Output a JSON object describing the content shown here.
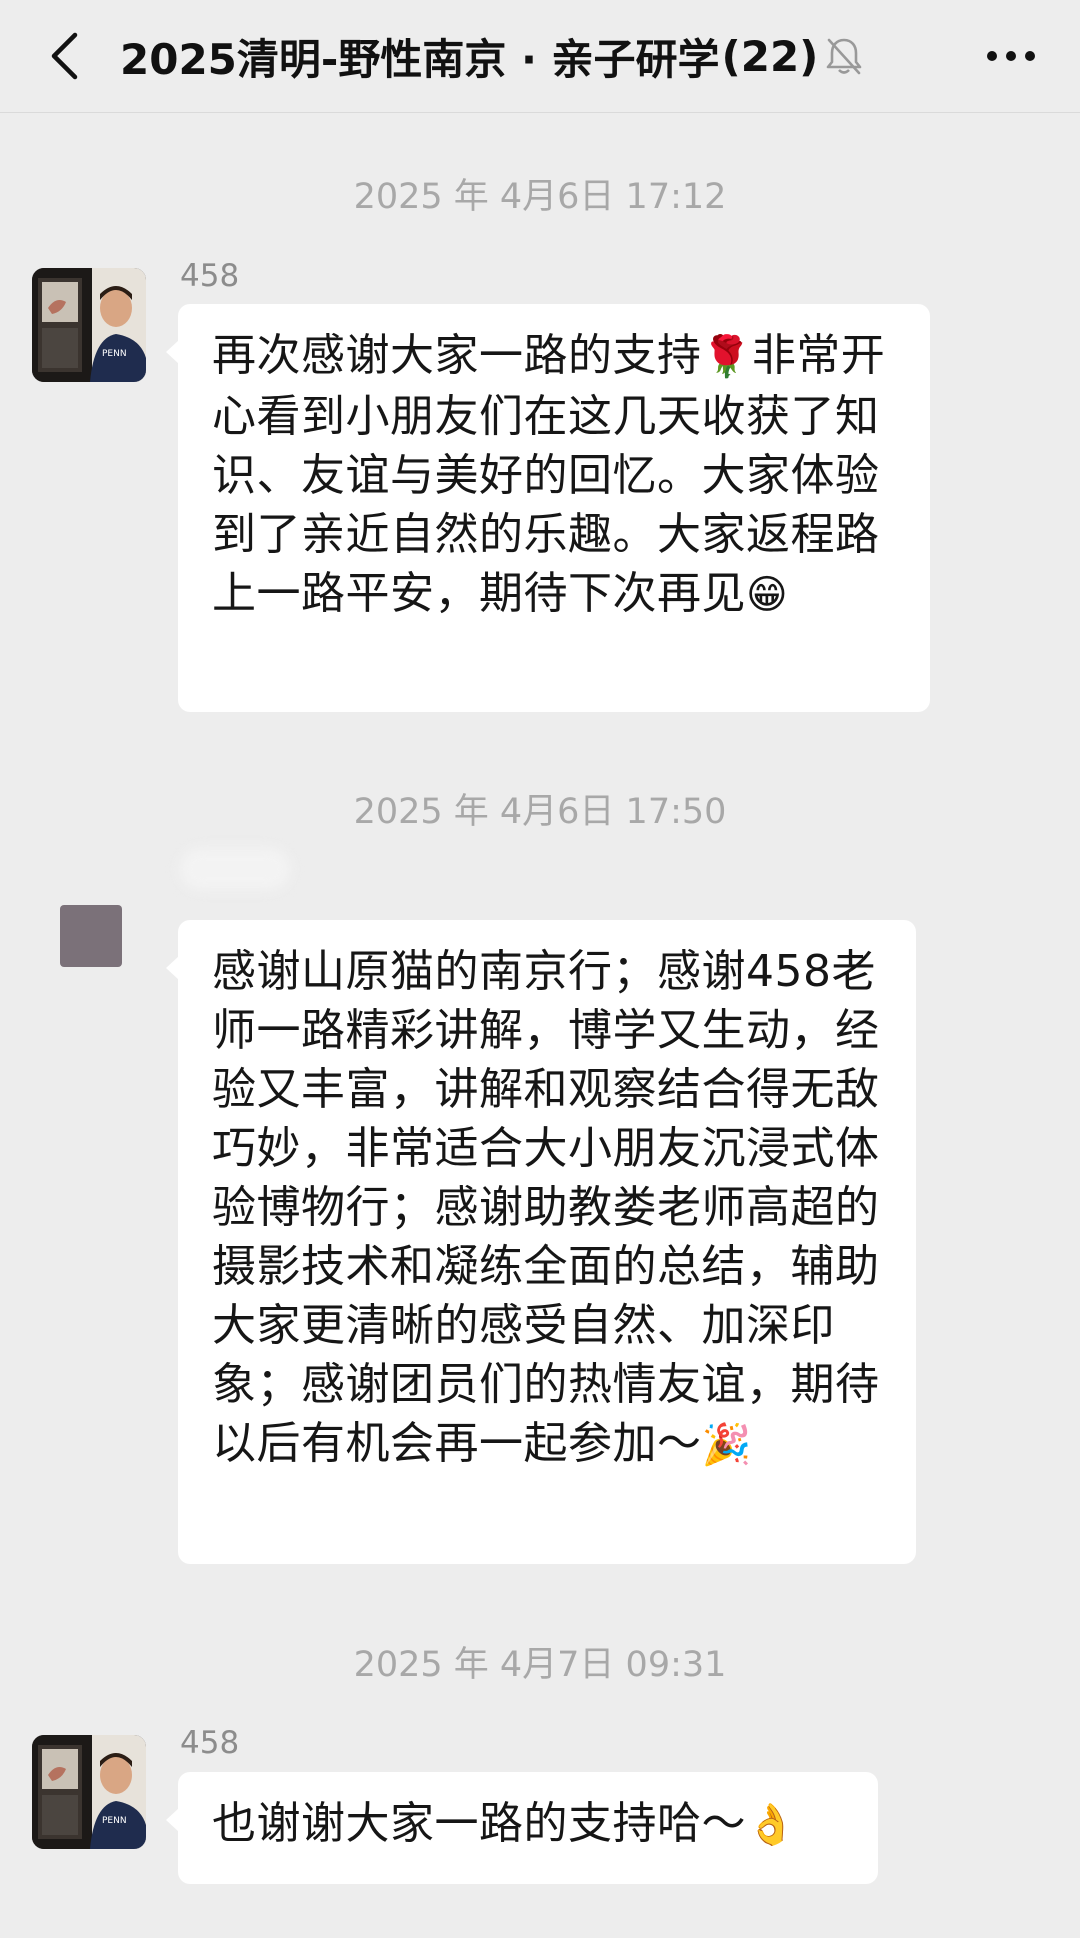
{
  "header": {
    "title": "2025清明-野性南京 · 亲子研学",
    "count": "(22)",
    "back_icon": "chevron-left-icon",
    "mute_icon": "bell-muted-icon",
    "more_icon": "more-dots-icon"
  },
  "messages": [
    {
      "timestamp": "2025 年 4月6日 17:12",
      "sender": "458",
      "text_before": "再次感谢大家一路的支持",
      "emoji_1": "🌹",
      "text_middle": "非常开心看到小朋友们在这几天收获了知识、友谊与美好的回忆。大家体验到了亲近自然的乐趣。大家返程路上一路平安，期待下次再见",
      "emoji_2": "😁"
    },
    {
      "timestamp": "2025 年 4月6日 17:50",
      "sender": "",
      "text": "感谢山原猫的南京行；感谢458老师一路精彩讲解，博学又生动，经验又丰富，讲解和观察结合得无敌巧妙，非常适合大小朋友沉浸式体验博物行；感谢助教娄老师高超的摄影技术和凝练全面的总结，辅助大家更清晰的感受自然、加深印象；感谢团员们的热情友谊，期待以后有机会再一起参加～",
      "emoji": "🎉"
    },
    {
      "timestamp": "2025 年 4月7日 09:31",
      "sender": "458",
      "text": "也谢谢大家一路的支持哈～",
      "emoji": "👌"
    }
  ]
}
